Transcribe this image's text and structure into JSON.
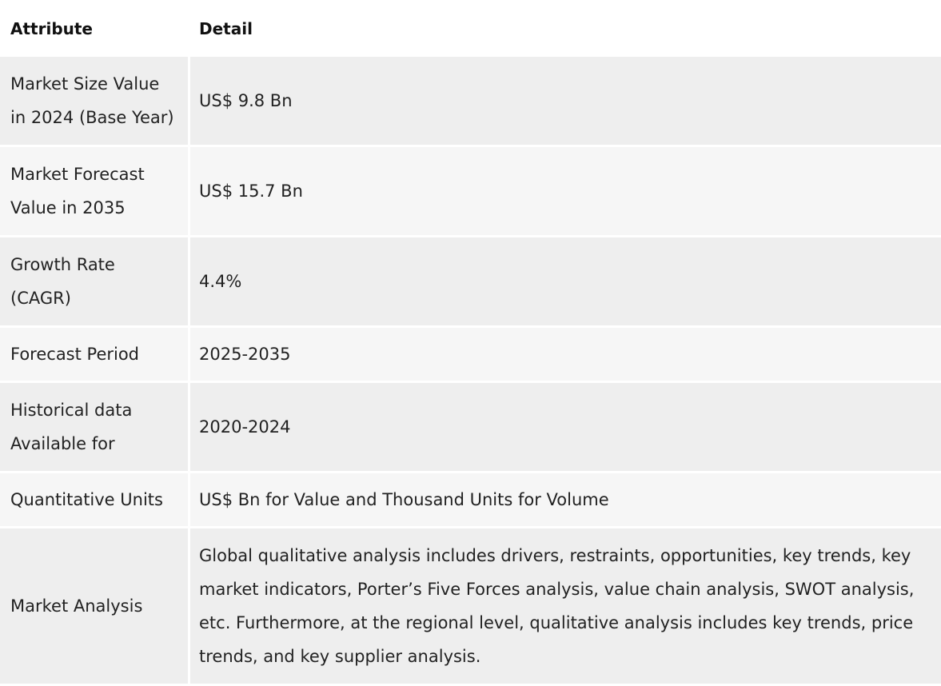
{
  "table": {
    "headers": [
      "Attribute",
      "Detail"
    ],
    "rows": [
      {
        "attribute": "Market Size Value in 2024 (Base Year)",
        "detail": "US$ 9.8 Bn"
      },
      {
        "attribute": "Market Forecast Value in 2035",
        "detail": "US$ 15.7 Bn"
      },
      {
        "attribute": "Growth Rate (CAGR)",
        "detail": "4.4%"
      },
      {
        "attribute": "Forecast Period",
        "detail": "2025-2035"
      },
      {
        "attribute": "Historical data Available for",
        "detail": "2020-2024"
      },
      {
        "attribute": "Quantitative Units",
        "detail": "US$ Bn for Value and Thousand Units for Volume"
      },
      {
        "attribute": "Market Analysis",
        "detail": "Global qualitative analysis includes drivers, restraints, opportunities, key trends, key market indicators, Porter’s Five Forces analysis, value chain analysis, SWOT analysis, etc. Furthermore, at the regional level, qualitative analysis includes key trends, price trends, and key supplier analysis."
      }
    ]
  }
}
